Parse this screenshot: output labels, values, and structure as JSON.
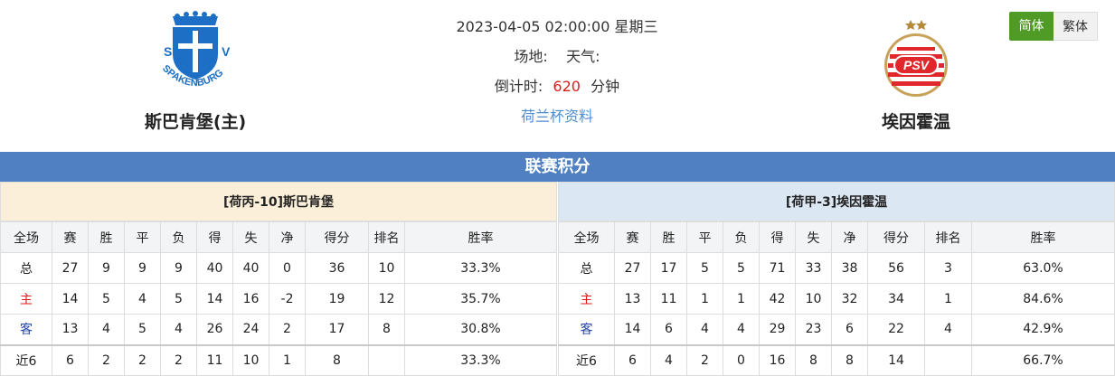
{
  "match": {
    "datetime": "2023-04-05 02:00:00 星期三",
    "venue_label": "场地:",
    "weather_label": "天气:",
    "countdown_label": "倒计时:",
    "countdown_value": "620",
    "countdown_unit": "分钟",
    "league_link": "荷兰杯资料"
  },
  "home_team": {
    "name": "斯巴肯堡(主)",
    "logo_text": "SPAKENBURG",
    "logo_letters": [
      "S",
      "V"
    ]
  },
  "away_team": {
    "name": "埃因霍温",
    "logo_text": "PSV"
  },
  "lang": {
    "simplified": "简体",
    "traditional": "繁体"
  },
  "section_title": "联赛积分",
  "columns": [
    "全场",
    "赛",
    "胜",
    "平",
    "负",
    "得",
    "失",
    "净",
    "得分",
    "排名",
    "胜率"
  ],
  "home_standings": {
    "title": "[荷丙-10]斯巴肯堡",
    "rows": [
      [
        "总",
        "27",
        "9",
        "9",
        "9",
        "40",
        "40",
        "0",
        "36",
        "10",
        "33.3%"
      ],
      [
        "主",
        "14",
        "5",
        "4",
        "5",
        "14",
        "16",
        "-2",
        "19",
        "12",
        "35.7%"
      ],
      [
        "客",
        "13",
        "4",
        "5",
        "4",
        "26",
        "24",
        "2",
        "17",
        "8",
        "30.8%"
      ],
      [
        "近6",
        "6",
        "2",
        "2",
        "2",
        "11",
        "10",
        "1",
        "8",
        "",
        "33.3%"
      ]
    ]
  },
  "away_standings": {
    "title": "[荷甲-3]埃因霍温",
    "rows": [
      [
        "总",
        "27",
        "17",
        "5",
        "5",
        "71",
        "33",
        "38",
        "56",
        "3",
        "63.0%"
      ],
      [
        "主",
        "13",
        "11",
        "1",
        "1",
        "42",
        "10",
        "32",
        "34",
        "1",
        "84.6%"
      ],
      [
        "客",
        "14",
        "6",
        "4",
        "4",
        "29",
        "23",
        "6",
        "22",
        "4",
        "42.9%"
      ],
      [
        "近6",
        "6",
        "4",
        "2",
        "0",
        "16",
        "8",
        "8",
        "14",
        "",
        "66.7%"
      ]
    ]
  },
  "colors": {
    "accent_bar": "#5080c2",
    "home_red": "#e01b1b",
    "away_blue": "#2343a6",
    "lang_active": "#4f9b26"
  }
}
